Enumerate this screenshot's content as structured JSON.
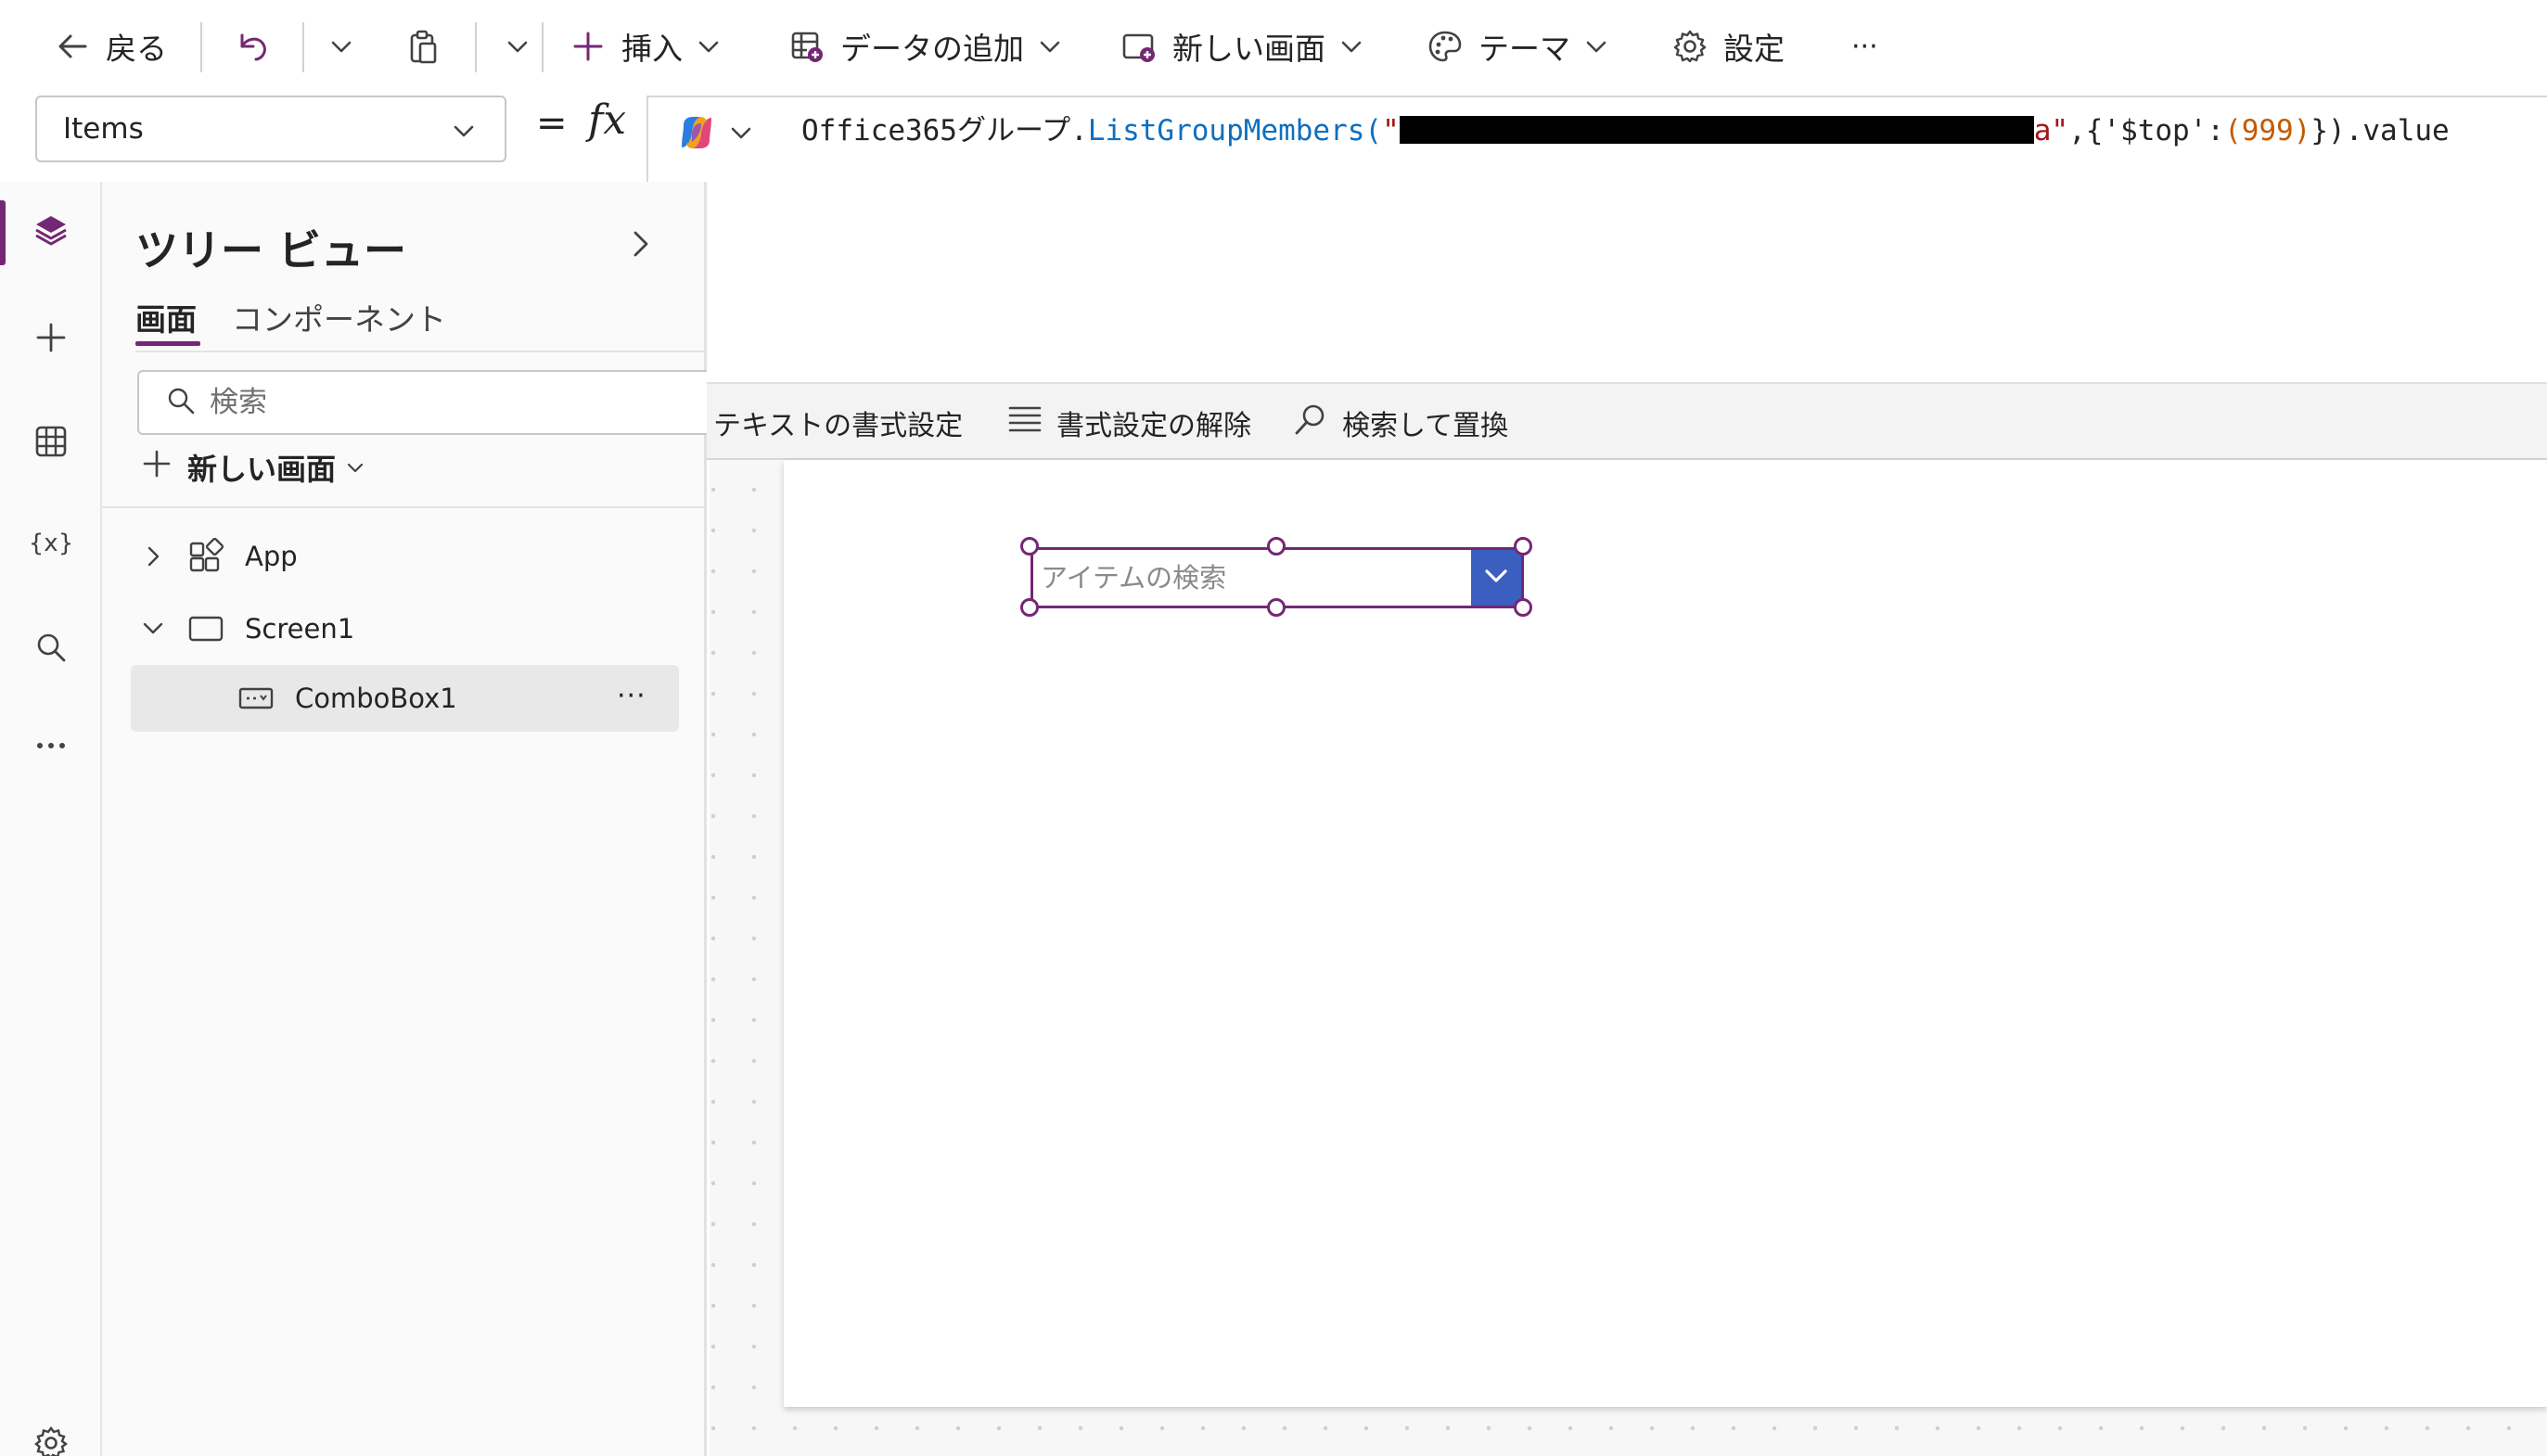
{
  "toolbar": {
    "back_label": "戻る",
    "insert_label": "挿入",
    "add_data_label": "データの追加",
    "new_screen_label": "新しい画面",
    "theme_label": "テーマ",
    "settings_label": "設定",
    "more_label": "···"
  },
  "formula_bar": {
    "property": "Items",
    "equals": "=",
    "fx": "fx",
    "formula": {
      "prefix": "Office365グループ.",
      "function": "ListGroupMembers",
      "open": "(",
      "quote_open": "\"",
      "string_tail": "a\"",
      "mid": ",{'$top':",
      "number": "(999)",
      "suffix": "}).value"
    },
    "format_text_label": "テキストの書式設定",
    "remove_format_label": "書式設定の解除",
    "find_replace_label": "検索して置換"
  },
  "tree_view": {
    "title": "ツリー ビュー",
    "tabs": {
      "screens": "画面",
      "components": "コンポーネント"
    },
    "search_placeholder": "検索",
    "new_screen_label": "新しい画面",
    "nodes": {
      "app": "App",
      "screen1": "Screen1",
      "combobox1": "ComboBox1"
    },
    "more": "···"
  },
  "canvas": {
    "combobox_placeholder": "アイテムの検索"
  },
  "colors": {
    "accent": "#742774",
    "combobox_button": "#3b5fc0",
    "function_blue": "#0e6fbf",
    "string_red": "#a31515",
    "number_orange": "#c25b00"
  }
}
